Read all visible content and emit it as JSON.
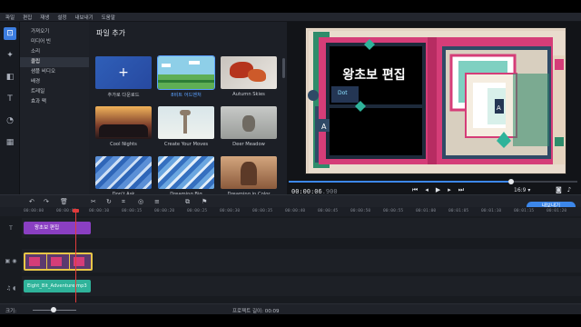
{
  "menu": [
    "파일",
    "편집",
    "재생",
    "설정",
    "내보내기",
    "도움말"
  ],
  "categories": [
    "가져오기",
    "미디어 빈",
    "소리",
    "클립",
    "샘플 비디오",
    "배경",
    "트레일",
    "효과 팩"
  ],
  "media": {
    "title": "파일 추가",
    "tiles": [
      {
        "label": "추가로 다운로드",
        "selected": false
      },
      {
        "label": "8비트 어드벤처",
        "selected": true
      },
      {
        "label": "Autumn Skies",
        "selected": false
      },
      {
        "label": "Cool Nights",
        "selected": false
      },
      {
        "label": "Create Your Moves",
        "selected": false
      },
      {
        "label": "Deer Meadow",
        "selected": false
      },
      {
        "label": "Don't Ask",
        "selected": false
      },
      {
        "label": "Dreaming Big",
        "selected": false
      },
      {
        "label": "Dreaming in Color",
        "selected": false
      }
    ]
  },
  "preview": {
    "overlay_title": "왕초보 편집",
    "overlay_small_letter": "A",
    "card_text": "Dot",
    "time_current": "00:00:06",
    "time_frames": ".900",
    "aspect": "16:9 ▾",
    "progress_fraction": 0.76
  },
  "timeline": {
    "export_label": "내보내기",
    "ruler": [
      "00:00:00",
      "00:00:05",
      "00:00:10",
      "00:00:15",
      "00:00:20",
      "00:00:25",
      "00:00:30",
      "00:00:35",
      "00:00:40",
      "00:00:45",
      "00:00:50",
      "00:00:55",
      "00:01:00",
      "00:01:05",
      "00:01:10",
      "00:01:15",
      "00:01:20"
    ],
    "title_clip": "왕초보 편집",
    "audio_clip": "Eight_Bit_Adventure.mp3"
  },
  "status": {
    "zoom_label": "크기:",
    "duration_label": "프로젝트 길이: 00:09"
  }
}
